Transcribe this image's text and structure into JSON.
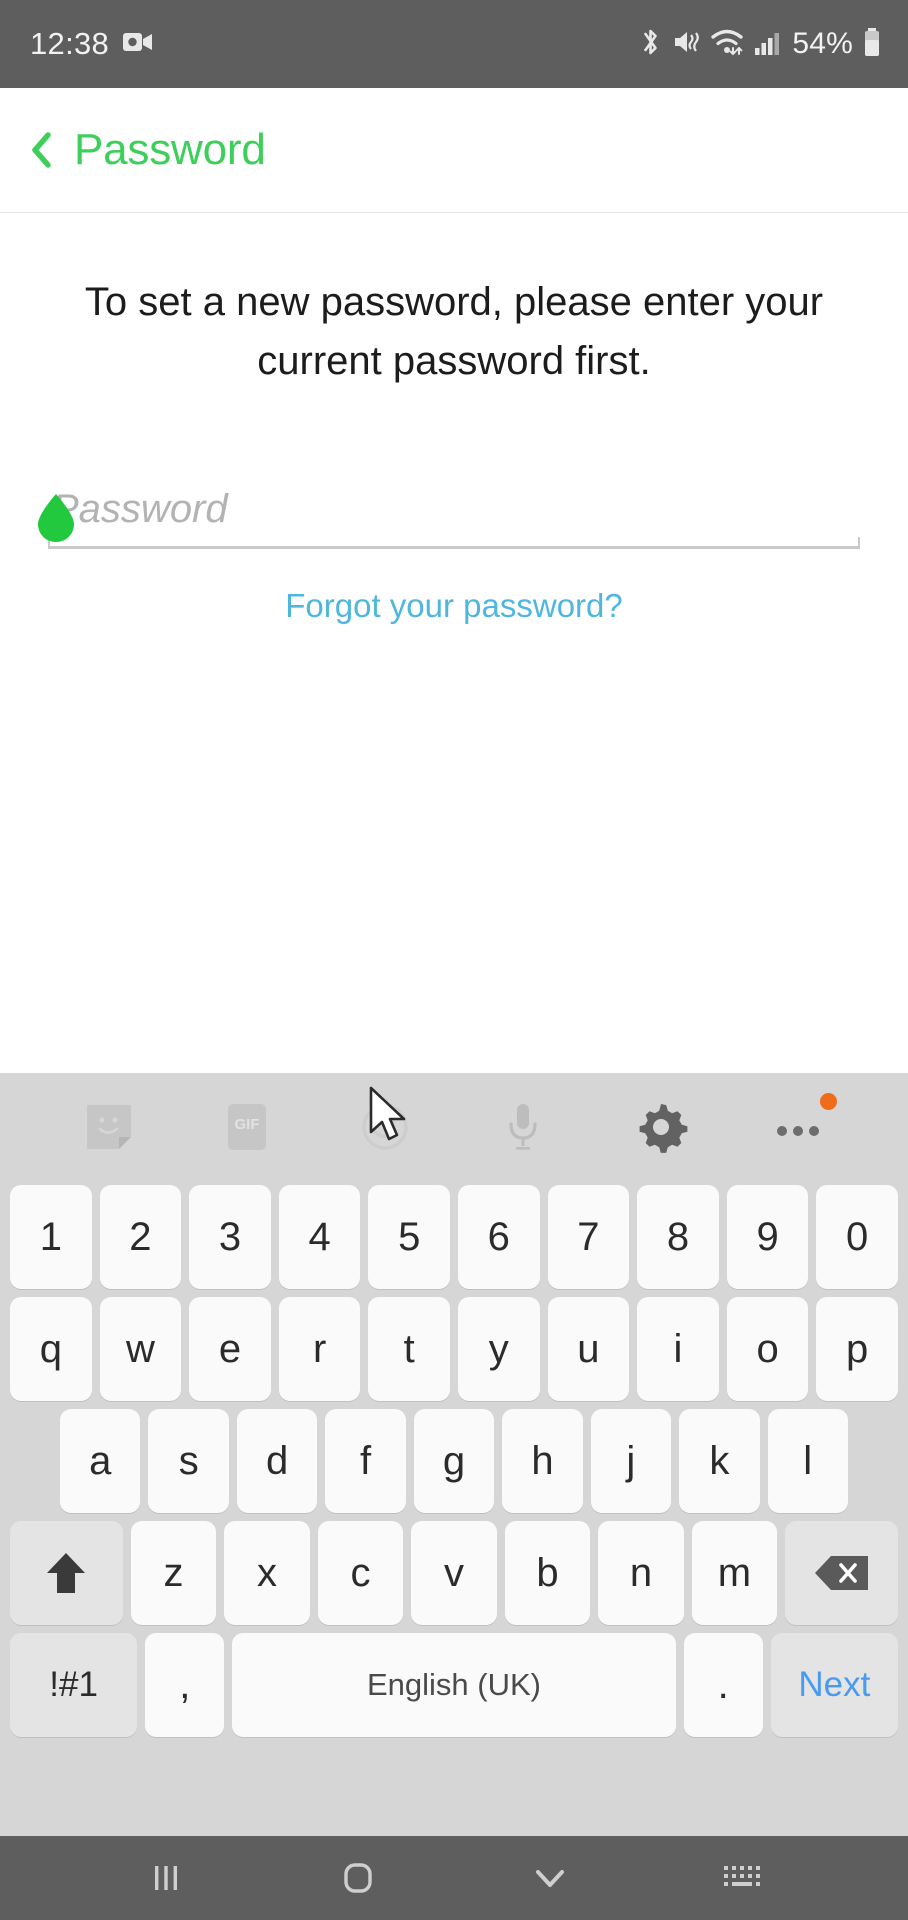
{
  "status_bar": {
    "time": "12:38",
    "battery_percent": "54%",
    "icons": [
      "screen-record-icon",
      "bluetooth-icon",
      "mute-vibrate-icon",
      "wifi-icon",
      "cellular-signal-icon",
      "battery-icon"
    ]
  },
  "header": {
    "title": "Password",
    "back_icon": "chevron-left-icon",
    "accent_color": "#3ECF5A"
  },
  "main": {
    "instruction": "To set a new password, please enter your current password first.",
    "password_field": {
      "placeholder": "Password",
      "value": ""
    },
    "forgot_link": "Forgot your password?",
    "link_color": "#4FB7DD",
    "cursor_handle_color": "#22C93F"
  },
  "keyboard": {
    "toolbar": [
      {
        "name": "sticker-icon",
        "label": ""
      },
      {
        "name": "gif-icon",
        "label": "GIF"
      },
      {
        "name": "emoji-icon",
        "label": ""
      },
      {
        "name": "microphone-icon",
        "label": ""
      },
      {
        "name": "gear-icon",
        "label": ""
      },
      {
        "name": "more-options-icon",
        "label": "",
        "badge": true
      }
    ],
    "badge_color": "#ef6c1a",
    "rows": {
      "numbers": [
        "1",
        "2",
        "3",
        "4",
        "5",
        "6",
        "7",
        "8",
        "9",
        "0"
      ],
      "top": [
        "q",
        "w",
        "e",
        "r",
        "t",
        "y",
        "u",
        "i",
        "o",
        "p"
      ],
      "home": [
        "a",
        "s",
        "d",
        "f",
        "g",
        "h",
        "j",
        "k",
        "l"
      ],
      "bottom": [
        "z",
        "x",
        "c",
        "v",
        "b",
        "n",
        "m"
      ]
    },
    "shift_icon": "shift-arrow-up-icon",
    "backspace_icon": "backspace-icon",
    "symbols_key": "!#1",
    "comma_key": ",",
    "space_key": "English (UK)",
    "period_key": ".",
    "next_key": "Next",
    "next_key_color": "#4a9bef"
  },
  "nav_bar": {
    "recents": "recents-icon",
    "home": "home-icon",
    "dismiss_keyboard": "chevron-down-icon",
    "keyboard_switch": "keyboard-switch-icon"
  }
}
